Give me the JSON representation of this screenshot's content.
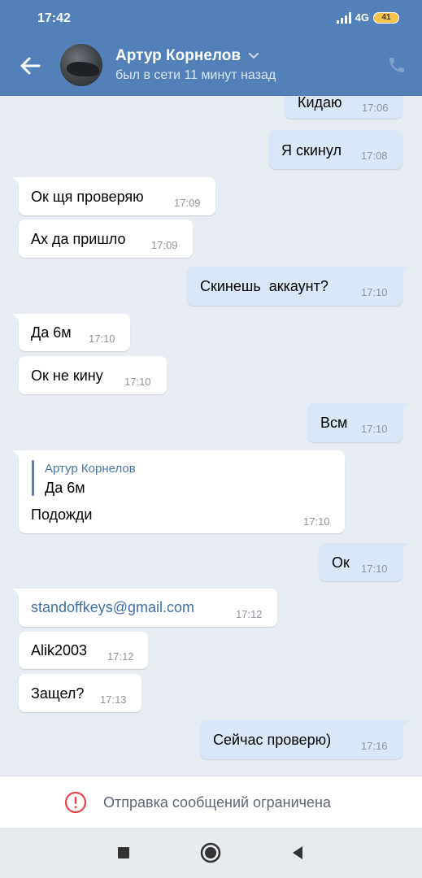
{
  "status": {
    "time": "17:42",
    "network": "4G",
    "battery": "41"
  },
  "header": {
    "name": "Артур Корнелов",
    "subtitle": "был в сети 11 минут назад",
    "accent": "#5181b8"
  },
  "messages": [
    {
      "dir": "out",
      "text": "Кидаю",
      "time": "17:06"
    },
    {
      "dir": "out",
      "text": "Я скинул",
      "time": "17:08"
    },
    {
      "dir": "in",
      "text": "Ок щя проверяю",
      "time": "17:09"
    },
    {
      "dir": "in",
      "text": "Ах да пришло",
      "time": "17:09"
    },
    {
      "dir": "out",
      "text": "Скинешь  аккаунт?",
      "time": "17:10"
    },
    {
      "dir": "in",
      "text": "Да 6м",
      "time": "17:10"
    },
    {
      "dir": "in",
      "text": "Ок не кину",
      "time": "17:10"
    },
    {
      "dir": "out",
      "text": "Всм",
      "time": "17:10"
    },
    {
      "dir": "in",
      "reply_author": "Артур Корнелов",
      "reply_text": "Да 6м",
      "text": "Подожди",
      "time": "17:10"
    },
    {
      "dir": "out",
      "text": "Ок",
      "time": "17:10"
    },
    {
      "dir": "in",
      "text": "standoffkeys@gmail.com",
      "time": "17:12",
      "is_link": true
    },
    {
      "dir": "in",
      "text": "Alik2003",
      "time": "17:12"
    },
    {
      "dir": "in",
      "text": "Защел?",
      "time": "17:13"
    },
    {
      "dir": "out",
      "text": "Сейчас проверю)",
      "time": "17:16"
    }
  ],
  "restriction": {
    "text": "Отправка сообщений ограничена",
    "icon": "alert-circle-icon",
    "color": "#e64646"
  },
  "navbar": {
    "icons": [
      "recent-apps-icon",
      "home-icon",
      "back-nav-icon"
    ]
  }
}
